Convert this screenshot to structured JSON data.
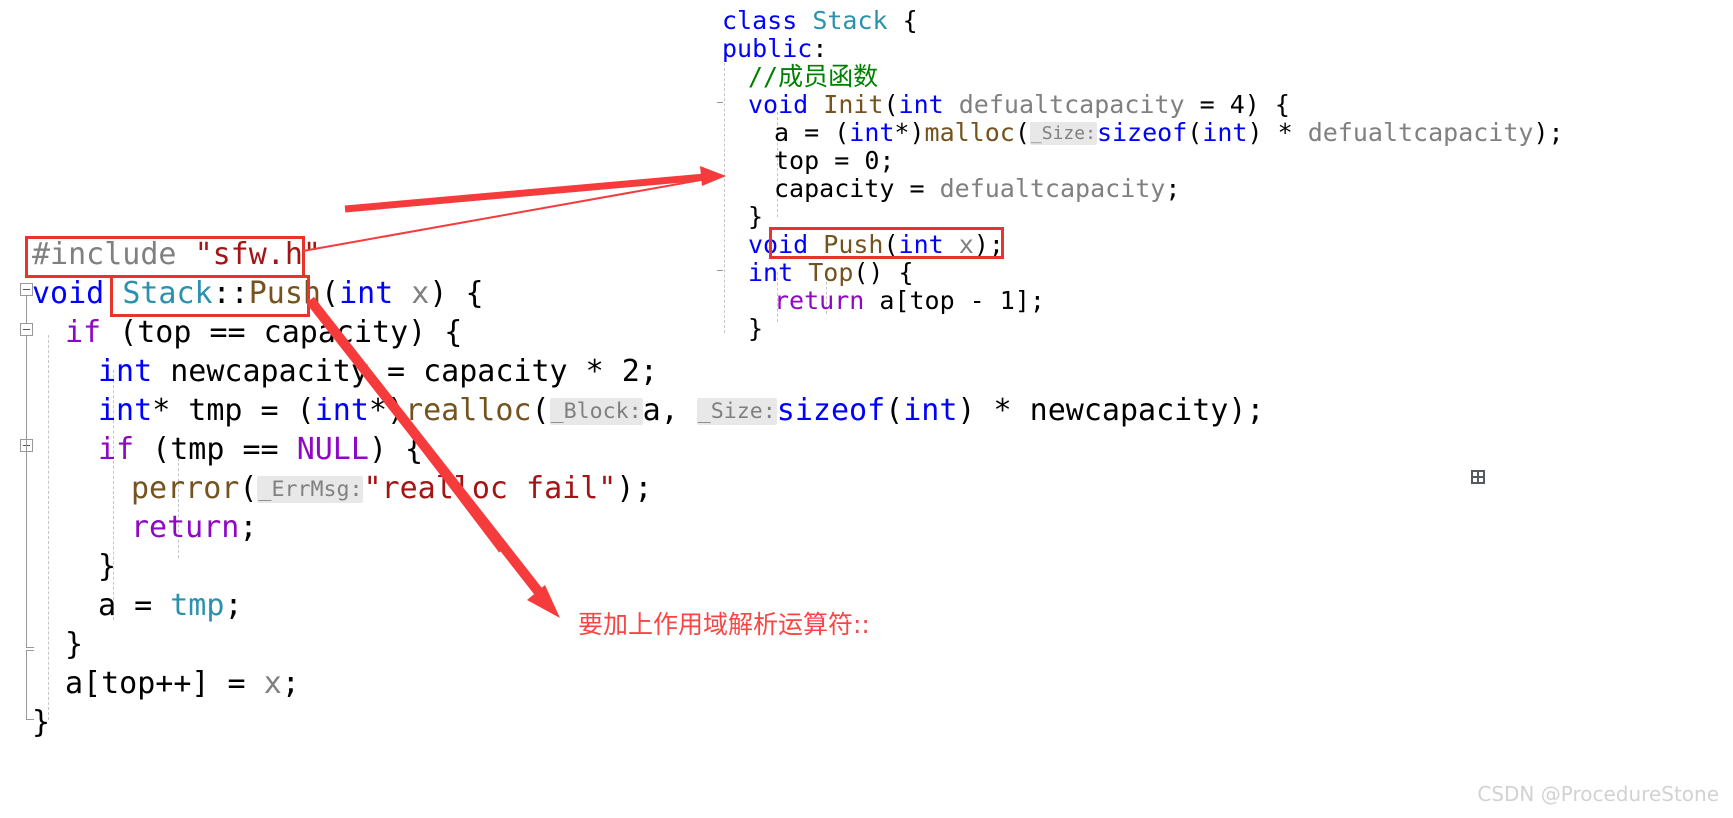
{
  "editor": {
    "app": "visual-studio-code-editor",
    "theme_background": "#ffffff"
  },
  "right_pane": {
    "name": "header-file-pane",
    "lines": [
      {
        "indent": 0,
        "tokens": [
          {
            "t": "class ",
            "c": "kw"
          },
          {
            "t": "Stack",
            "c": "type"
          },
          {
            "t": " {",
            "c": "pl"
          }
        ]
      },
      {
        "indent": 0,
        "tokens": [
          {
            "t": "public",
            "c": "kw"
          },
          {
            "t": ":",
            "c": "pl"
          }
        ]
      },
      {
        "indent": 1,
        "tokens": [
          {
            "t": "//成员函数",
            "c": "cmt"
          }
        ]
      },
      {
        "indent": 1,
        "tokens": [
          {
            "t": "void ",
            "c": "kw"
          },
          {
            "t": "Init",
            "c": "fn"
          },
          {
            "t": "(",
            "c": "pl"
          },
          {
            "t": "int",
            "c": "kw"
          },
          {
            "t": " defualtcapacity",
            "c": "var"
          },
          {
            "t": " = ",
            "c": "pl"
          },
          {
            "t": "4",
            "c": "num"
          },
          {
            "t": ") {",
            "c": "pl"
          }
        ]
      },
      {
        "indent": 2,
        "tokens": [
          {
            "t": "a = (",
            "c": "pl"
          },
          {
            "t": "int",
            "c": "kw"
          },
          {
            "t": "*)",
            "c": "pl"
          },
          {
            "t": "malloc",
            "c": "fn"
          },
          {
            "t": "(",
            "c": "pl"
          },
          {
            "t": "_Size:",
            "c": "hint"
          },
          {
            "t": "sizeof",
            "c": "kw"
          },
          {
            "t": "(",
            "c": "pl"
          },
          {
            "t": "int",
            "c": "kw"
          },
          {
            "t": ") * ",
            "c": "pl"
          },
          {
            "t": "defualtcapacity",
            "c": "var"
          },
          {
            "t": ");",
            "c": "pl"
          }
        ]
      },
      {
        "indent": 2,
        "tokens": [
          {
            "t": "top = ",
            "c": "pl"
          },
          {
            "t": "0",
            "c": "num"
          },
          {
            "t": ";",
            "c": "pl"
          }
        ]
      },
      {
        "indent": 2,
        "tokens": [
          {
            "t": "capacity = ",
            "c": "pl"
          },
          {
            "t": "defualtcapacity",
            "c": "var"
          },
          {
            "t": ";",
            "c": "pl"
          }
        ]
      },
      {
        "indent": 1,
        "tokens": [
          {
            "t": "}",
            "c": "pl"
          }
        ]
      },
      {
        "indent": 1,
        "tokens": [
          {
            "t": "void ",
            "c": "kw"
          },
          {
            "t": "Push",
            "c": "fn"
          },
          {
            "t": "(",
            "c": "pl"
          },
          {
            "t": "int",
            "c": "kw"
          },
          {
            "t": " x",
            "c": "var"
          },
          {
            "t": ");",
            "c": "pl"
          }
        ]
      },
      {
        "indent": 1,
        "tokens": [
          {
            "t": "int ",
            "c": "kw"
          },
          {
            "t": "Top",
            "c": "fn"
          },
          {
            "t": "() {",
            "c": "pl"
          }
        ]
      },
      {
        "indent": 2,
        "tokens": [
          {
            "t": "return",
            "c": "kw2"
          },
          {
            "t": " a[top - ",
            "c": "pl"
          },
          {
            "t": "1",
            "c": "num"
          },
          {
            "t": "];",
            "c": "pl"
          }
        ]
      },
      {
        "indent": 1,
        "tokens": [
          {
            "t": "}",
            "c": "pl"
          }
        ]
      }
    ]
  },
  "left_pane": {
    "name": "source-file-pane",
    "lines": [
      {
        "indent": 0,
        "tokens": [
          {
            "t": "#include ",
            "c": "var"
          },
          {
            "t": "\"sfw.h\"",
            "c": "str"
          }
        ]
      },
      {
        "indent": 0,
        "tokens": [
          {
            "t": "void ",
            "c": "kw"
          },
          {
            "t": "Stack",
            "c": "type"
          },
          {
            "t": "::",
            "c": "pl"
          },
          {
            "t": "Push",
            "c": "fn"
          },
          {
            "t": "(",
            "c": "pl"
          },
          {
            "t": "int",
            "c": "kw"
          },
          {
            "t": " x",
            "c": "var"
          },
          {
            "t": ") {",
            "c": "pl"
          }
        ]
      },
      {
        "indent": 1,
        "tokens": [
          {
            "t": "if",
            "c": "kw2"
          },
          {
            "t": " (top == capacity) {",
            "c": "pl"
          }
        ]
      },
      {
        "indent": 2,
        "tokens": [
          {
            "t": "int",
            "c": "kw"
          },
          {
            "t": " newcapacity = capacity * ",
            "c": "pl"
          },
          {
            "t": "2",
            "c": "num"
          },
          {
            "t": ";",
            "c": "pl"
          }
        ]
      },
      {
        "indent": 2,
        "tokens": [
          {
            "t": "int",
            "c": "kw"
          },
          {
            "t": "* tmp = (",
            "c": "pl"
          },
          {
            "t": "int",
            "c": "kw"
          },
          {
            "t": "*)",
            "c": "pl"
          },
          {
            "t": "realloc",
            "c": "fn"
          },
          {
            "t": "(",
            "c": "pl"
          },
          {
            "t": "_Block:",
            "c": "hint"
          },
          {
            "t": "a, ",
            "c": "pl"
          },
          {
            "t": "_Size:",
            "c": "hint"
          },
          {
            "t": "sizeof",
            "c": "kw"
          },
          {
            "t": "(",
            "c": "pl"
          },
          {
            "t": "int",
            "c": "kw"
          },
          {
            "t": ") * newcapacity);",
            "c": "pl"
          }
        ]
      },
      {
        "indent": 2,
        "tokens": [
          {
            "t": "if",
            "c": "kw2"
          },
          {
            "t": " (tmp == ",
            "c": "pl"
          },
          {
            "t": "NULL",
            "c": "kw2"
          },
          {
            "t": ") {",
            "c": "pl"
          }
        ]
      },
      {
        "indent": 3,
        "tokens": [
          {
            "t": "perror",
            "c": "fn"
          },
          {
            "t": "(",
            "c": "pl"
          },
          {
            "t": "_ErrMsg:",
            "c": "hint"
          },
          {
            "t": "\"realloc fail\"",
            "c": "str"
          },
          {
            "t": ");",
            "c": "pl"
          }
        ]
      },
      {
        "indent": 3,
        "tokens": [
          {
            "t": "return",
            "c": "kw2"
          },
          {
            "t": ";",
            "c": "pl"
          }
        ]
      },
      {
        "indent": 2,
        "tokens": [
          {
            "t": "}",
            "c": "pl"
          }
        ]
      },
      {
        "indent": 2,
        "tokens": [
          {
            "t": "a = ",
            "c": "pl"
          },
          {
            "t": "tmp",
            "c": "type"
          },
          {
            "t": ";",
            "c": "pl"
          }
        ]
      },
      {
        "indent": 1,
        "tokens": [
          {
            "t": "}",
            "c": "pl"
          }
        ]
      },
      {
        "indent": 1,
        "tokens": [
          {
            "t": "a[top++] = ",
            "c": "pl"
          },
          {
            "t": "x",
            "c": "var"
          },
          {
            "t": ";",
            "c": "pl"
          }
        ]
      },
      {
        "indent": 0,
        "tokens": [
          {
            "t": "}",
            "c": "pl"
          }
        ]
      }
    ]
  },
  "annotations": {
    "note_text": "要加上作用域解析运算符::",
    "note_color": "#fb4545",
    "box_color": "#e8342a",
    "arrow_color": "#f53b3b",
    "boxes": [
      {
        "name": "include-highlight-box",
        "label": "#include \"sfw.h\""
      },
      {
        "name": "scope-qualifier-box",
        "label": "Stack::Push"
      },
      {
        "name": "declaration-box",
        "label": "void Push(int x);"
      }
    ]
  },
  "watermark": {
    "text": "CSDN @ProcedureStone"
  },
  "icons": {
    "quick_actions": "grid-icon"
  }
}
